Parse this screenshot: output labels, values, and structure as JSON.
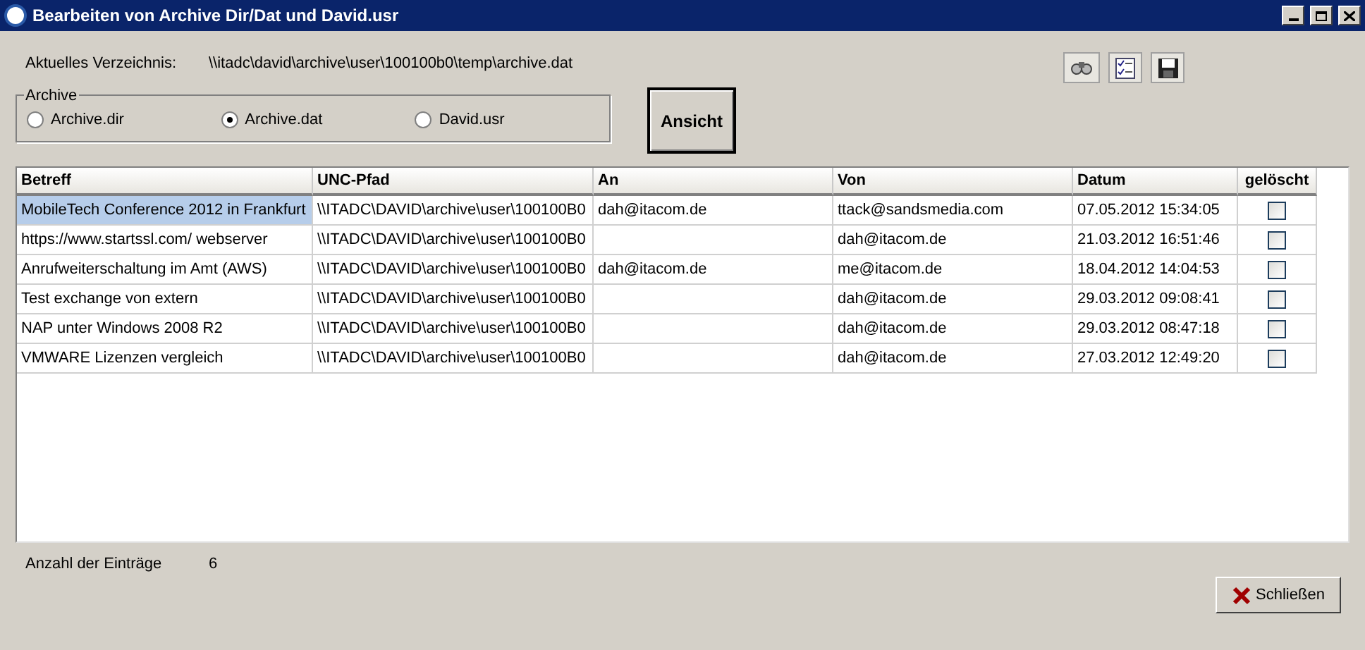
{
  "window": {
    "title": "Bearbeiten von Archive Dir/Dat und David.usr"
  },
  "directory": {
    "label": "Aktuelles Verzeichnis:",
    "value": "\\\\itadc\\david\\archive\\user\\100100b0\\temp\\archive.dat"
  },
  "archive_group": {
    "title": "Archive",
    "options": [
      {
        "label": "Archive.dir",
        "selected": false
      },
      {
        "label": "Archive.dat",
        "selected": true
      },
      {
        "label": "David.usr",
        "selected": false
      }
    ]
  },
  "view_button": "Ansicht",
  "table": {
    "columns": [
      "Betreff",
      "UNC-Pfad",
      "An",
      "Von",
      "Datum",
      "gelöscht"
    ],
    "rows": [
      {
        "betreff": "MobileTech Conference 2012 in Frankfurt",
        "unc": "\\\\ITADC\\DAVID\\archive\\user\\100100B0",
        "an": "dah@itacom.de",
        "von": "ttack@sandsmedia.com",
        "datum": "07.05.2012 15:34:05",
        "deleted": false,
        "selected": true
      },
      {
        "betreff": "https://www.startssl.com/ webserver",
        "unc": "\\\\ITADC\\DAVID\\archive\\user\\100100B0",
        "an": "",
        "von": "dah@itacom.de",
        "datum": "21.03.2012 16:51:46",
        "deleted": false,
        "selected": false
      },
      {
        "betreff": "Anrufweiterschaltung im Amt (AWS)",
        "unc": "\\\\ITADC\\DAVID\\archive\\user\\100100B0",
        "an": "dah@itacom.de",
        "von": "me@itacom.de",
        "datum": "18.04.2012 14:04:53",
        "deleted": false,
        "selected": false
      },
      {
        "betreff": "Test exchange von extern",
        "unc": "\\\\ITADC\\DAVID\\archive\\user\\100100B0",
        "an": "",
        "von": "dah@itacom.de",
        "datum": "29.03.2012 09:08:41",
        "deleted": false,
        "selected": false
      },
      {
        "betreff": "NAP unter Windows 2008 R2",
        "unc": "\\\\ITADC\\DAVID\\archive\\user\\100100B0",
        "an": "",
        "von": "dah@itacom.de",
        "datum": "29.03.2012 08:47:18",
        "deleted": false,
        "selected": false
      },
      {
        "betreff": "VMWARE Lizenzen vergleich",
        "unc": "\\\\ITADC\\DAVID\\archive\\user\\100100B0",
        "an": "",
        "von": "dah@itacom.de",
        "datum": "27.03.2012 12:49:20",
        "deleted": false,
        "selected": false
      }
    ]
  },
  "count": {
    "label": "Anzahl der Einträge",
    "value": "6"
  },
  "close_button": "Schließen"
}
